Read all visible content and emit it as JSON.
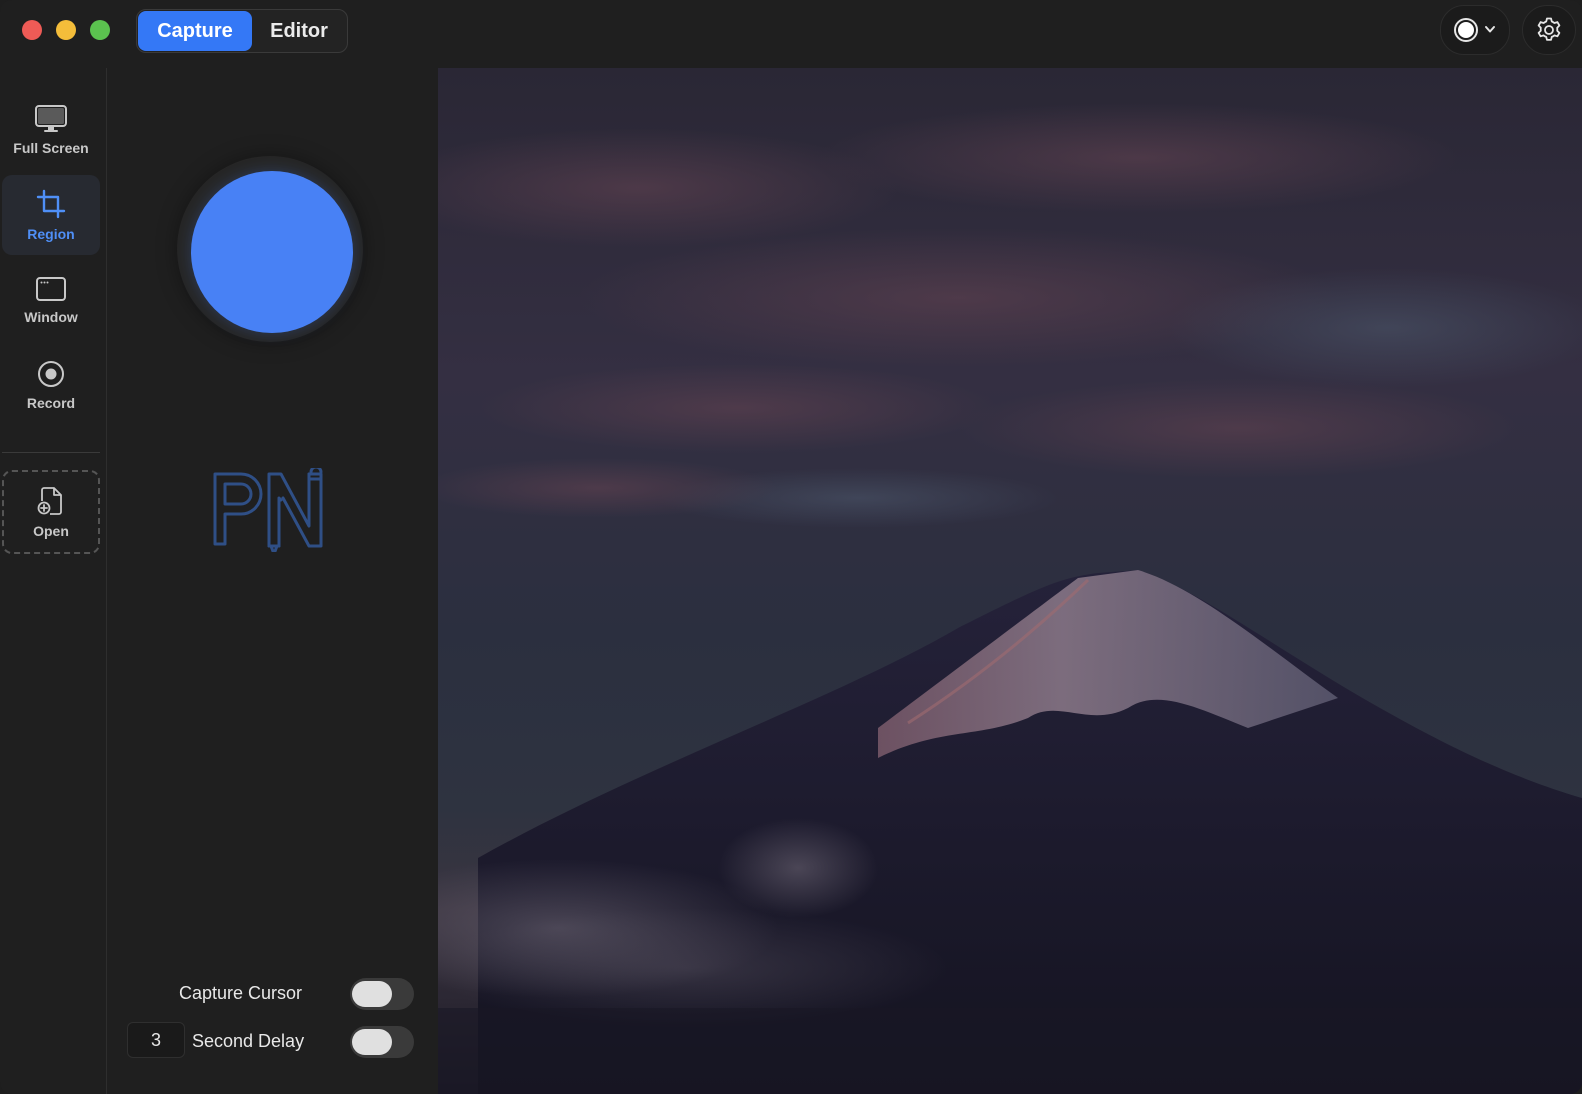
{
  "header": {
    "tabs": [
      {
        "label": "Capture",
        "active": true
      },
      {
        "label": "Editor",
        "active": false
      }
    ]
  },
  "sidebar": {
    "tools": [
      {
        "label": "Full Screen",
        "icon": "monitor-icon",
        "selected": false
      },
      {
        "label": "Region",
        "icon": "crop-icon",
        "selected": true
      },
      {
        "label": "Window",
        "icon": "window-icon",
        "selected": false
      },
      {
        "label": "Record",
        "icon": "record-icon",
        "selected": false
      }
    ],
    "open": {
      "label": "Open",
      "icon": "file-add-icon"
    }
  },
  "panel": {
    "options": {
      "capture_cursor": {
        "label": "Capture Cursor",
        "enabled": false
      },
      "delay": {
        "value": "3",
        "label": "Second Delay",
        "enabled": false
      }
    }
  },
  "colors": {
    "accent": "#3478f6",
    "capture_button": "#4881f5",
    "close": "#ee5b56",
    "minimize": "#f4bd3a",
    "maximize": "#5bc24f"
  }
}
